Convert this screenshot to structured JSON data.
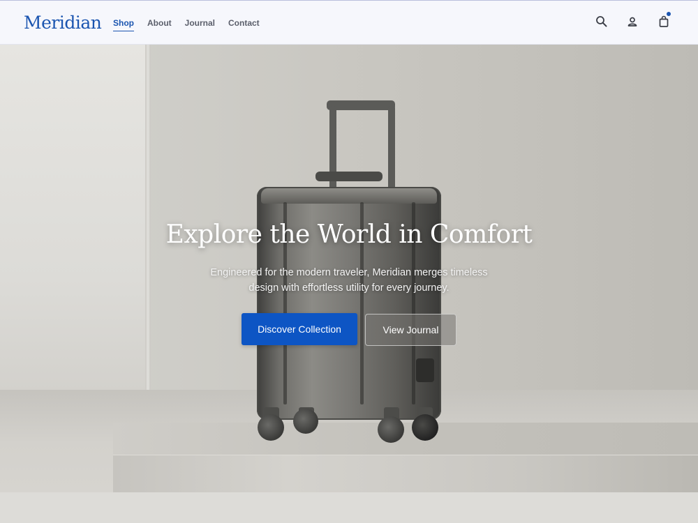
{
  "header": {
    "logo": "Meridian",
    "nav": [
      {
        "label": "Shop",
        "active": true
      },
      {
        "label": "About",
        "active": false
      },
      {
        "label": "Journal",
        "active": false
      },
      {
        "label": "Contact",
        "active": false
      }
    ],
    "icons": [
      "search-icon",
      "account-icon",
      "shopping-bag-icon"
    ],
    "cart_badge": true,
    "accent_color": "#1b55b0"
  },
  "hero": {
    "title": "Explore the World in Comfort",
    "subtitle_line1": "Engineered for the modern traveler, Meridian merges timeless",
    "subtitle_line2": "design with effortless utility for every journey.",
    "primary_cta": "Discover Collection",
    "secondary_cta": "View Journal",
    "primary_color": "#0d55c4"
  }
}
